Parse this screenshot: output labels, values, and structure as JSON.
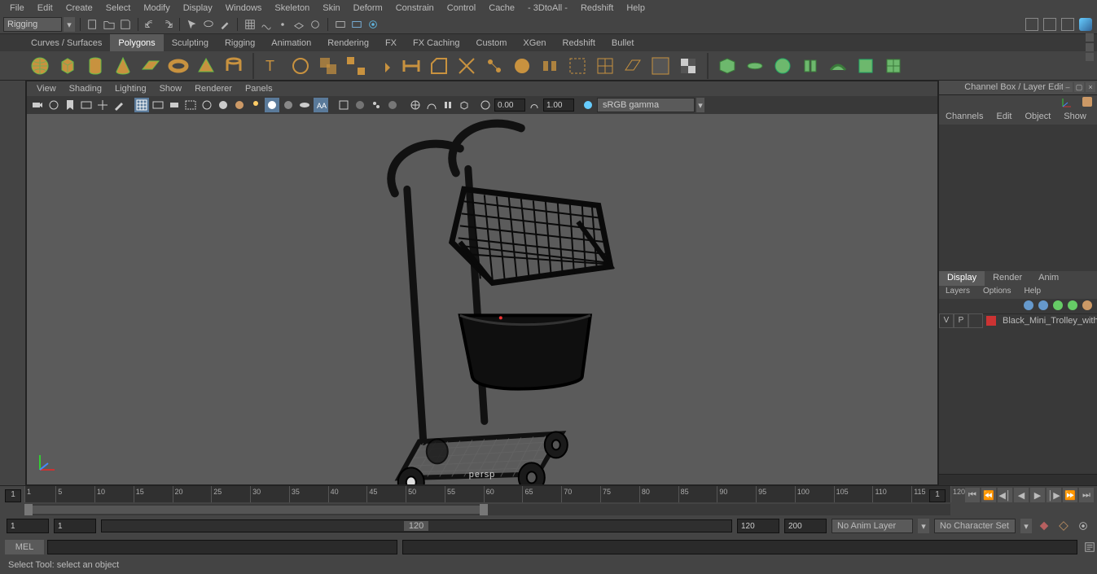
{
  "menu": [
    "File",
    "Edit",
    "Create",
    "Select",
    "Modify",
    "Display",
    "Windows",
    "Skeleton",
    "Skin",
    "Deform",
    "Constrain",
    "Control",
    "Cache",
    "- 3DtoAll -",
    "Redshift",
    "Help"
  ],
  "workspace_dropdown": "Rigging",
  "shelf_tabs": [
    "Curves / Surfaces",
    "Polygons",
    "Sculpting",
    "Rigging",
    "Animation",
    "Rendering",
    "FX",
    "FX Caching",
    "Custom",
    "XGen",
    "Redshift",
    "Bullet"
  ],
  "shelf_active_index": 1,
  "viewport_menu": [
    "View",
    "Shading",
    "Lighting",
    "Show",
    "Renderer",
    "Panels"
  ],
  "vp_field1": "0.00",
  "vp_field2": "1.00",
  "vp_colorspace": "sRGB gamma",
  "vp_camera_label": "persp",
  "side": {
    "title": "Channel Box / Layer Editor",
    "tabs": [
      "Channels",
      "Edit",
      "Object",
      "Show"
    ],
    "disp_tabs": [
      "Display",
      "Render",
      "Anim"
    ],
    "disp_active_index": 0,
    "layer_sub": [
      "Layers",
      "Options",
      "Help"
    ],
    "layer_v": "V",
    "layer_p": "P",
    "layer_name": "Black_Mini_Trolley_with_",
    "layer_color": "#cc3333"
  },
  "time": {
    "ticks": [
      1,
      5,
      10,
      15,
      20,
      25,
      30,
      35,
      40,
      45,
      50,
      55,
      60,
      65,
      70,
      75,
      80,
      85,
      90,
      95,
      100,
      105,
      110,
      115,
      120
    ],
    "cur_frame_left": "1",
    "cur_frame_right": "1",
    "start": "1",
    "inner_start": "1",
    "inner_end": "120",
    "end_a": "120",
    "end_b": "200",
    "anim_layer": "No Anim Layer",
    "char_set": "No Character Set"
  },
  "cmd_label": "MEL",
  "help_text": "Select Tool: select an object"
}
